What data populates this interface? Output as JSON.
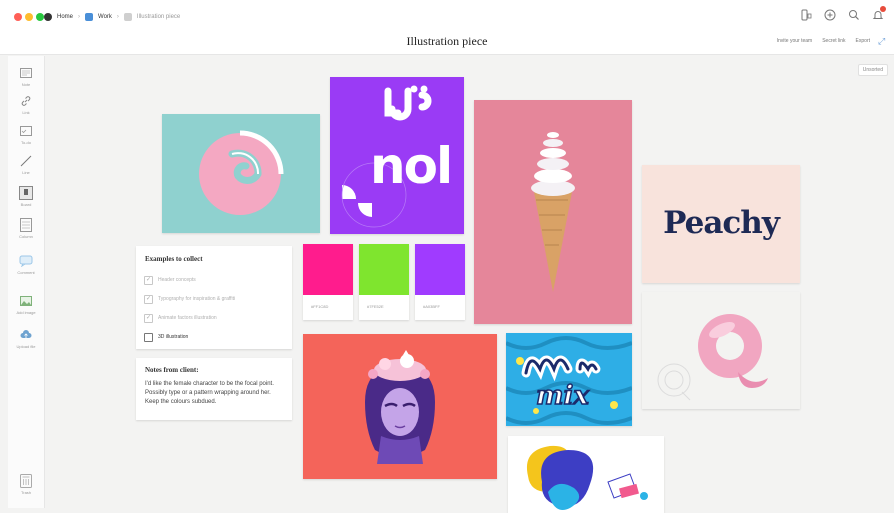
{
  "window": {
    "breadcrumb": {
      "workspace": "Home",
      "board": "Work",
      "page": "Illustration piece"
    },
    "toolbar_icons": [
      "phone-icon",
      "plus-circle-icon",
      "search-icon",
      "bell-icon"
    ]
  },
  "board": {
    "title": "Illustration piece",
    "actions": [
      "Invite your team",
      "Secret link",
      "Export"
    ],
    "unsorted_label": "Unsorted"
  },
  "sidebar": {
    "tools": [
      {
        "icon": "note-icon",
        "label": "Note"
      },
      {
        "icon": "link-icon",
        "label": "Link"
      },
      {
        "icon": "todo-icon",
        "label": "To-do"
      },
      {
        "icon": "line-icon",
        "label": "Line"
      },
      {
        "icon": "board-icon",
        "label": "Board"
      },
      {
        "icon": "column-icon",
        "label": "Column"
      },
      {
        "icon": "comment-icon",
        "label": "Comment"
      },
      {
        "icon": "add-image-icon",
        "label": "Add image"
      },
      {
        "icon": "upload-icon",
        "label": "Upload file"
      },
      {
        "icon": "trash-icon",
        "label": "Trash"
      }
    ]
  },
  "todo": {
    "title": "Examples to collect",
    "items": [
      {
        "label": "Header concepts",
        "done": true
      },
      {
        "label": "Typography for inspiration & graffiti",
        "done": true
      },
      {
        "label": "Animate factors illustration",
        "done": true
      },
      {
        "label": "3D illustration",
        "done": false
      }
    ]
  },
  "note": {
    "title": "Notes from client:",
    "body": "I'd like the female character to be the focal point. Possibly type or a pattern wrapping around her. Keep the colours subdued."
  },
  "swatches": [
    {
      "hex": "#FF1C8D",
      "label": "#FF1C8D"
    },
    {
      "hex": "#7FE52E",
      "label": "#7FE52E"
    },
    {
      "hex": "#A03BFF",
      "label": "#A03BFF"
    }
  ],
  "images": {
    "nol_text": "nol",
    "peachy_text": "Peachy",
    "mix_text": "mix"
  },
  "colors": {
    "teal": "#8fd1cf",
    "purple": "#9a3bf5",
    "pink": "#e5869a",
    "peach": "#f8e3dc",
    "coral": "#f4645a",
    "navy": "#1e2a55"
  }
}
